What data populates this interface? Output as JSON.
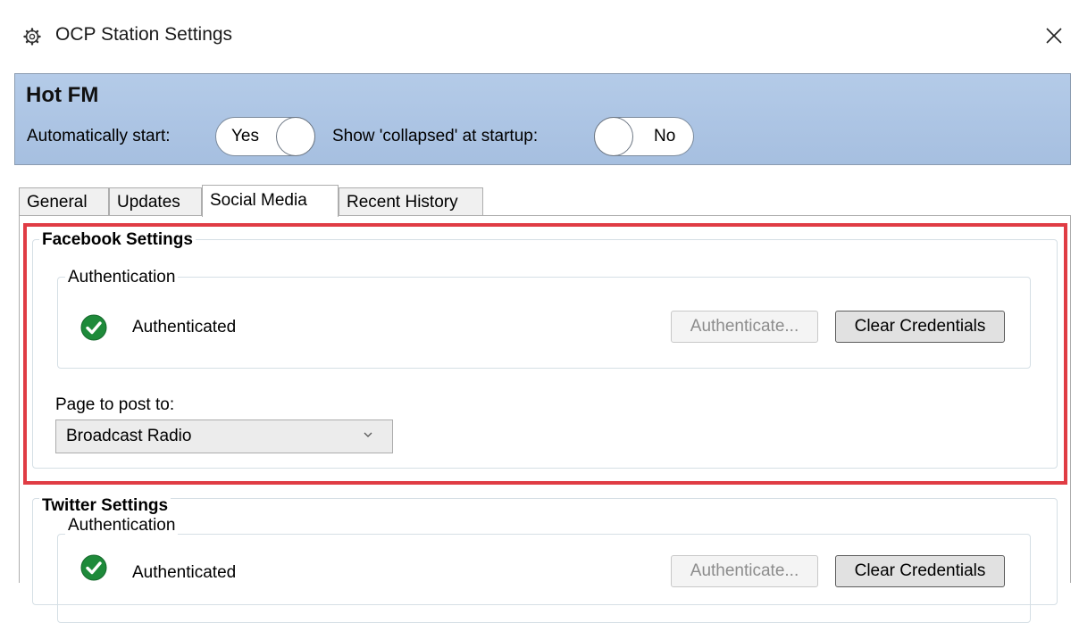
{
  "window": {
    "title": "OCP Station Settings",
    "icon": "gear-icon",
    "close_icon": "close-icon"
  },
  "header": {
    "station_name": "Hot FM",
    "auto_start_label": "Automatically start:",
    "auto_start_value": "Yes",
    "collapsed_label": "Show 'collapsed' at startup:",
    "collapsed_value": "No"
  },
  "tabs": [
    {
      "label": "General"
    },
    {
      "label": "Updates"
    },
    {
      "label": "Social Media",
      "active": true
    },
    {
      "label": "Recent History"
    }
  ],
  "facebook": {
    "title": "Facebook Settings",
    "auth_group_title": "Authentication",
    "status_text": "Authenticated",
    "status_icon": "check-circle-icon",
    "authenticate_label": "Authenticate...",
    "clear_label": "Clear Credentials",
    "page_label": "Page to post to:",
    "page_value": "Broadcast Radio"
  },
  "twitter": {
    "title": "Twitter Settings",
    "auth_group_title": "Authentication",
    "status_text": "Authenticated",
    "status_icon": "check-circle-icon",
    "authenticate_label": "Authenticate...",
    "clear_label": "Clear Credentials"
  },
  "colors": {
    "header_bg": "#a6bfe0",
    "highlight_border": "#e03c44",
    "check_green": "#1e8a3a"
  }
}
